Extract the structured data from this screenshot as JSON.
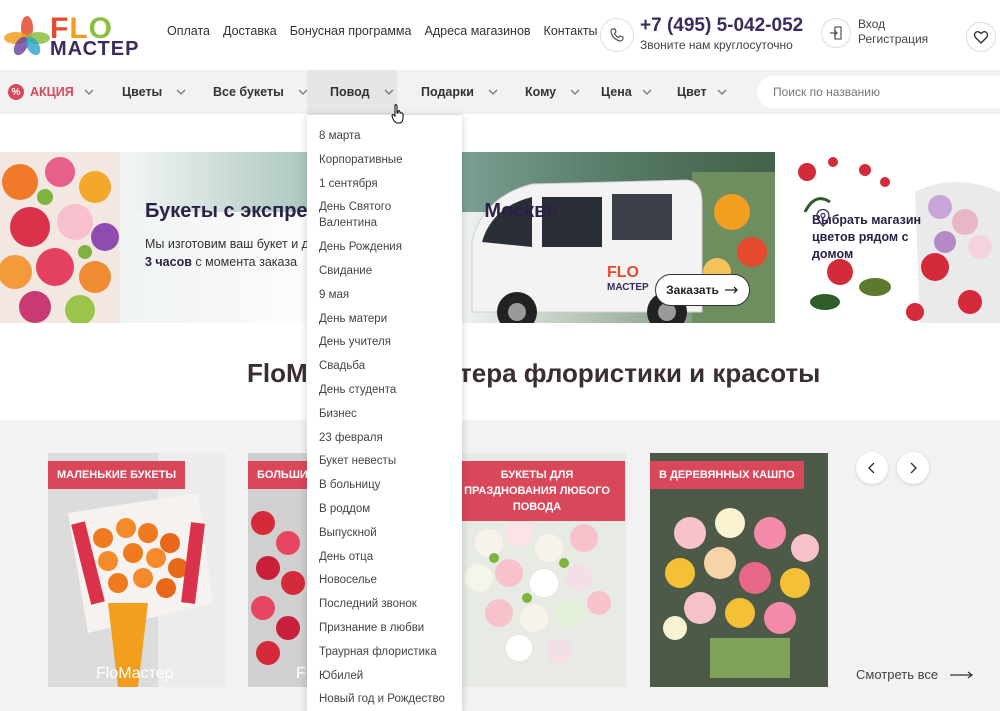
{
  "header": {
    "logo_top": "FLO",
    "logo_bottom": "МАСТЕР",
    "nav": [
      "Оплата",
      "Доставка",
      "Бонусная программа",
      "Адреса магазинов",
      "Контакты"
    ],
    "phone": "+7 (495) 5-042-052",
    "phone_sub": "Звоните нам круглосуточно",
    "login": "Вход",
    "register": "Регистрация"
  },
  "menu": {
    "sale": "АКЦИЯ",
    "items": [
      "Цветы",
      "Все букеты",
      "Повод",
      "Подарки",
      "Кому",
      "Цена",
      "Цвет"
    ],
    "search_placeholder": "Поиск по названию",
    "active": "Повод"
  },
  "banner": {
    "title": "Букеты с экспрес",
    "title_tail": "Москве",
    "sub_line1": "Мы изготовим ваш букет и д",
    "sub_bold": "3 часов",
    "sub_line2": " с момента заказа",
    "van_logo": "FLO",
    "van_logo_sub": "МАСТЕР",
    "button": "Заказать"
  },
  "side_banner": {
    "text": "Выбрать магазин цветов рядом с домом"
  },
  "section": {
    "title_left": "FloM",
    "title_right": "тера флористики и красоты"
  },
  "cards": [
    {
      "label": "МАЛЕНЬКИЕ БУКЕТЫ",
      "brand": "FloМастер"
    },
    {
      "label": "БОЛЬШИ",
      "brand": "F"
    },
    {
      "label": "БУКЕТЫ ДЛЯ ПРАЗДНОВАНИЯ ЛЮБОГО ПОВОДА",
      "brand": ""
    },
    {
      "label": "В ДЕРЕВЯННЫХ КАШПО",
      "brand": ""
    }
  ],
  "see_all": "Смотреть все",
  "dropdown": {
    "items": [
      "8 марта",
      "Корпоративные",
      "1 сентября",
      "День Святого Валентина",
      "День Рождения",
      "Свидание",
      "9 мая",
      "День матери",
      "День учителя",
      "Свадьба",
      "День студента",
      "Бизнес",
      "23 февраля",
      "Букет невесты",
      "В больницу",
      "В роддом",
      "Выпускной",
      "День отца",
      "Новоселье",
      "Последний звонок",
      "Признание в любви",
      "Траурная флористика",
      "Юбилей",
      "Новый год и Рождество"
    ]
  },
  "colors": {
    "accent": "#d9475a",
    "brand_dark": "#3b2b5c",
    "menu_bg": "#f2f2f2"
  }
}
